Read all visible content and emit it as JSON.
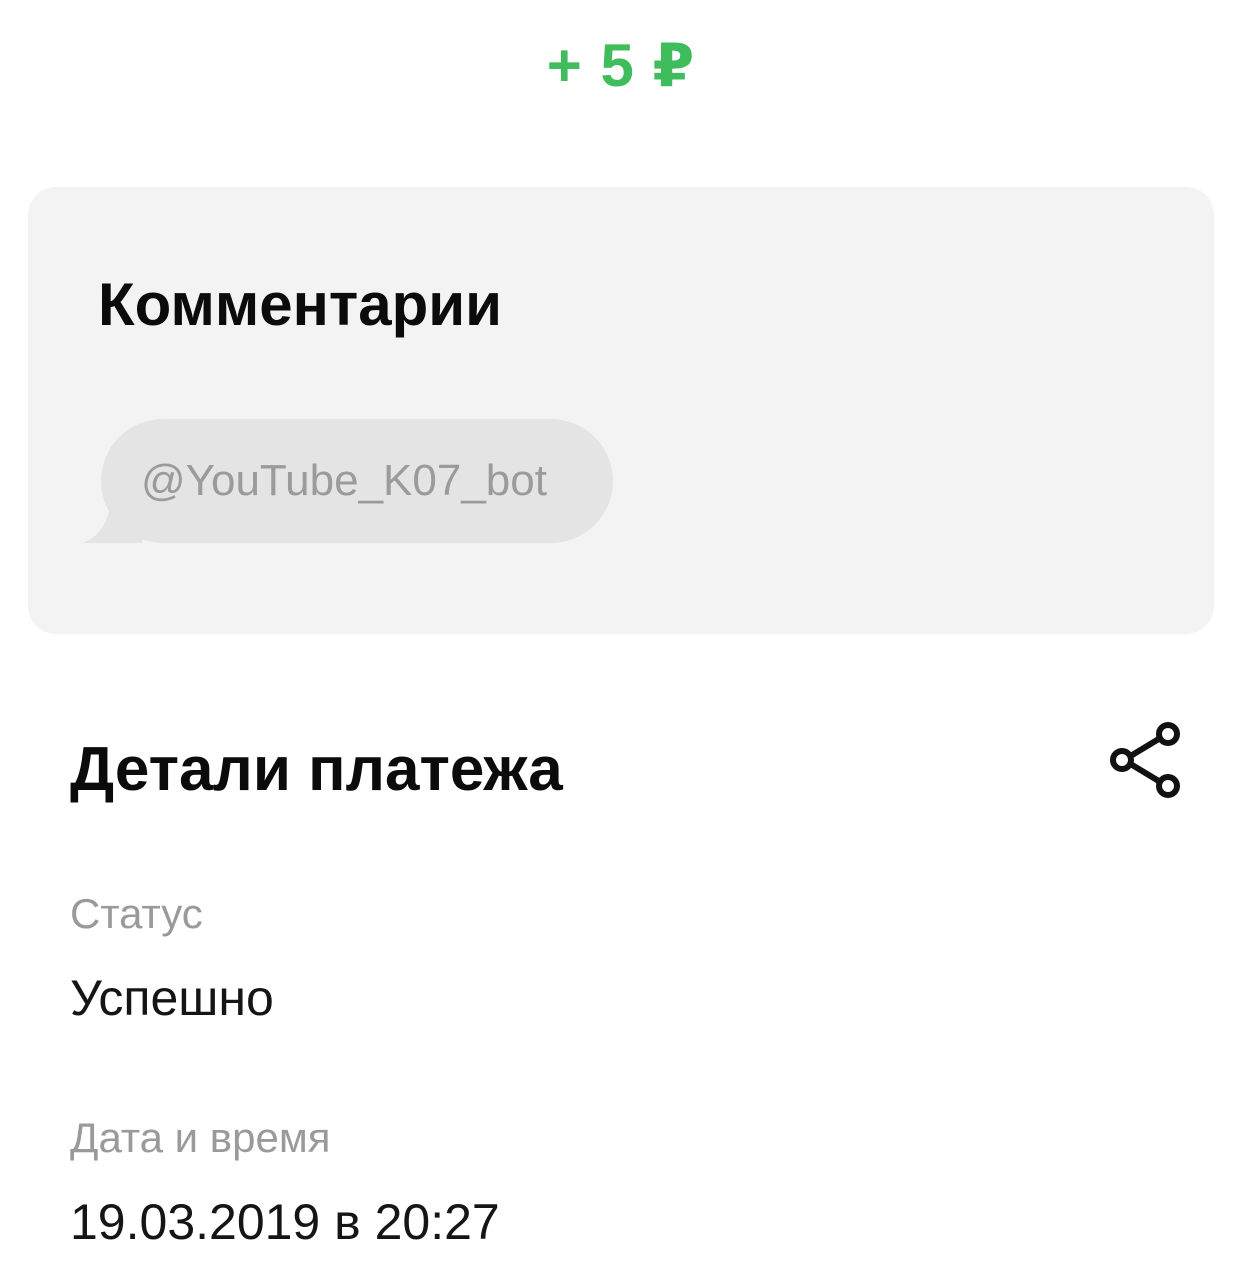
{
  "amount": {
    "text": "+ 5 ₽",
    "color": "#3fbc5b"
  },
  "comments": {
    "title": "Комментарии",
    "message": "@YouTube_K07_bot"
  },
  "payment_details": {
    "title": "Детали платежа",
    "share_icon": "share-icon",
    "fields": [
      {
        "label": "Статус",
        "value": "Успешно"
      },
      {
        "label": "Дата и время",
        "value": "19.03.2019 в 20:27"
      }
    ]
  }
}
